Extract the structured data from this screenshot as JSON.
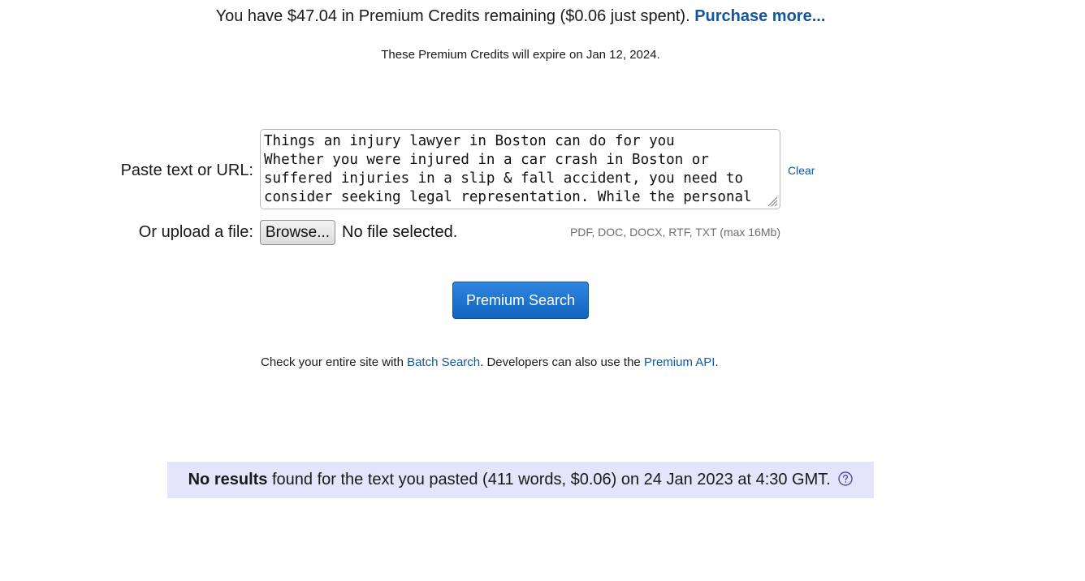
{
  "credits": {
    "text": "You have $47.04 in Premium Credits remaining ($0.06 just spent).",
    "purchase_link": "Purchase more...",
    "expire_text": "These Premium Credits will expire on Jan 12, 2024."
  },
  "form": {
    "paste_label": "Paste text or URL:",
    "paste_value": "Things an injury lawyer in Boston can do for you\nWhether you were injured in a car crash in Boston or\nsuffered injuries in a slip & fall accident, you need to\nconsider seeking legal representation. While the personal",
    "clear_link": "Clear",
    "upload_label": "Or upload a file:",
    "browse_label": "Browse...",
    "file_status": "No file selected.",
    "file_types": "PDF, DOC, DOCX, RTF, TXT (max 16Mb)",
    "search_button": "Premium Search"
  },
  "batch": {
    "prefix": "Check your entire site with ",
    "batch_link": "Batch Search",
    "middle": ". Developers can also use the ",
    "api_link": "Premium API",
    "suffix": "."
  },
  "results": {
    "bold": "No results",
    "text": " found for the text you pasted (411 words, $0.06) on 24 Jan 2023 at 4:30 GMT.",
    "help_icon": "question-circle-icon"
  },
  "colors": {
    "link": "#14569e",
    "button": "#1a6fcf",
    "results_bg": "#e4e4fa",
    "help_icon": "#4a4ab0"
  }
}
